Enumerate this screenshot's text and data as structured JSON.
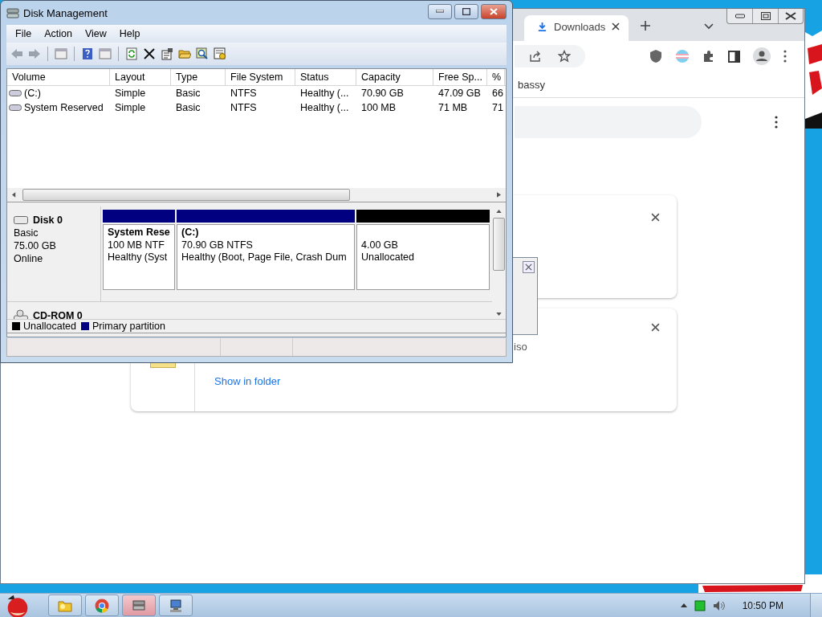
{
  "browser": {
    "tabs": [
      {
        "label": "Downloads",
        "selected": true
      }
    ],
    "bookmark": "bassy",
    "downloads": [
      {
        "kind": "hidden"
      },
      {
        "kind": "file",
        "filename": "iso",
        "action": "Show in folder"
      }
    ]
  },
  "dialog": {
    "kind": "dialog"
  },
  "disk_management": {
    "title": "Disk Management",
    "menu": [
      "File",
      "Action",
      "View",
      "Help"
    ],
    "columns": [
      "Volume",
      "Layout",
      "Type",
      "File System",
      "Status",
      "Capacity",
      "Free Sp...",
      "%"
    ],
    "rows": [
      {
        "cells": [
          "(C:)",
          "Simple",
          "Basic",
          "NTFS",
          "Healthy (...",
          "70.90 GB",
          "47.09 GB",
          "66"
        ]
      },
      {
        "cells": [
          "System Reserved",
          "Simple",
          "Basic",
          "NTFS",
          "Healthy (...",
          "100 MB",
          "71 MB",
          "71"
        ]
      }
    ],
    "disks": [
      {
        "name": "Disk 0",
        "type": "Basic",
        "size": "75.00 GB",
        "status": "Online",
        "partitions": [
          {
            "name": "System Rese",
            "size": "100 MB NTF",
            "status": "Healthy (Syst",
            "color": "#000080"
          },
          {
            "name": "(C:)",
            "size": "70.90 GB NTFS",
            "status": "Healthy (Boot, Page File, Crash Dum",
            "color": "#000080"
          },
          {
            "size": "4.00 GB",
            "status": "Unallocated",
            "color": "#000000"
          }
        ]
      }
    ],
    "cdrom": "CD-ROM 0",
    "legend": [
      {
        "label": "Unallocated",
        "color": "#000000"
      },
      {
        "label": "Primary partition",
        "color": "#000080"
      }
    ]
  },
  "taskbar": {
    "apps": [
      {
        "kind": "folder",
        "selected": false
      },
      {
        "kind": "browser",
        "selected": false
      },
      {
        "kind": "disk",
        "selected": true
      },
      {
        "kind": "network",
        "selected": false
      }
    ],
    "time": "10:50 PM"
  }
}
